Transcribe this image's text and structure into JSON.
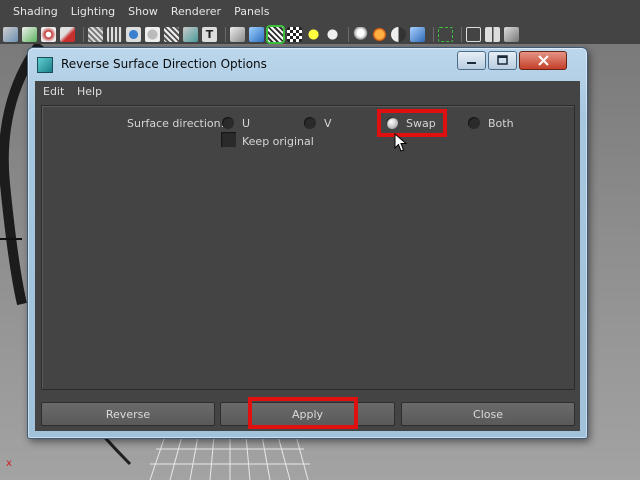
{
  "app": {
    "menu": [
      "Shading",
      "Lighting",
      "Show",
      "Renderer",
      "Panels"
    ],
    "toolbar_icons": [
      "camera-select-icon",
      "camera-attributes-icon",
      "bookmark-icon",
      "image-plane-icon",
      "grid-icon",
      "film-gate-icon",
      "resolution-gate-icon",
      "safe-action-icon",
      "field-chart-icon",
      "wireframe-icon",
      "smooth-shade-icon",
      "default-material-icon",
      "textured-icon",
      "use-lights-icon",
      "shadows-icon",
      "xray-icon",
      "isolate-select-icon",
      "highlight-icon"
    ],
    "viewport_axis_label": "x"
  },
  "dialog": {
    "title": "Reverse Surface Direction Options",
    "menu": [
      "Edit",
      "Help"
    ],
    "surface_direction_label": "Surface direction:",
    "options": [
      "U",
      "V",
      "Swap",
      "Both"
    ],
    "selected_option": "Swap",
    "keep_original_label": "Keep original",
    "keep_original_checked": false,
    "buttons": {
      "reverse": "Reverse",
      "apply": "Apply",
      "close": "Close"
    }
  },
  "colors": {
    "highlight": "#e01010",
    "dialog_bg": "#444444",
    "title_bar": "#a7c7e0"
  }
}
